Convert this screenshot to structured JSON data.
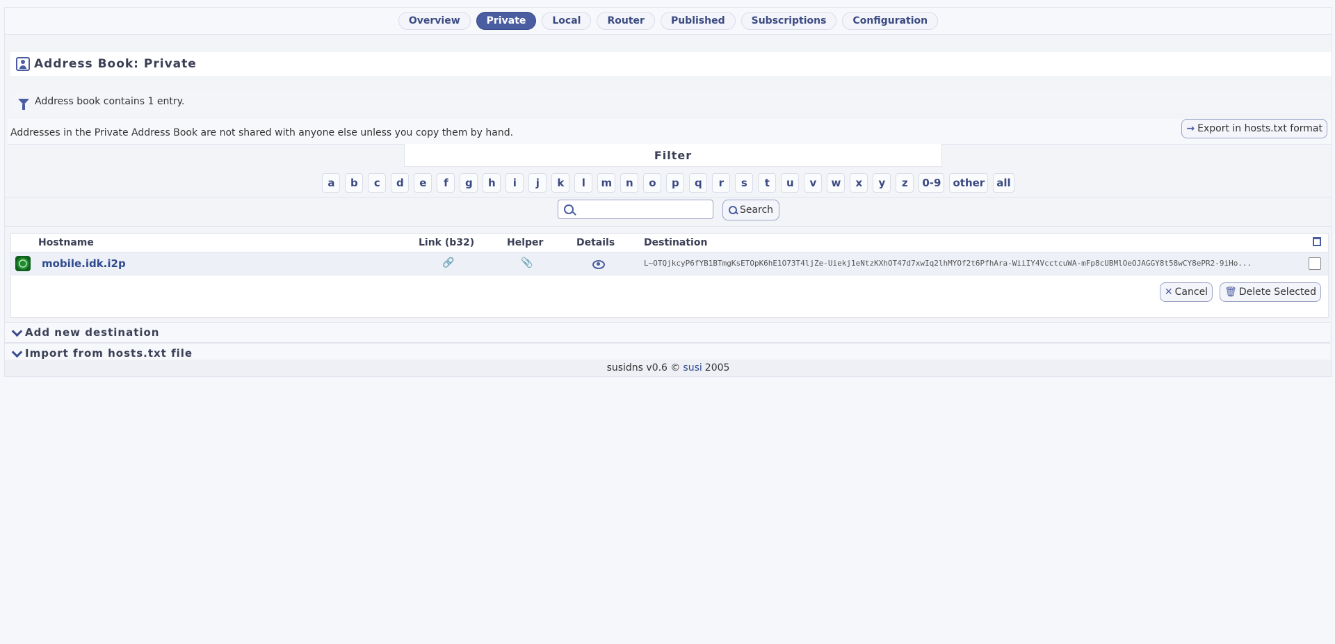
{
  "nav": {
    "tabs": [
      {
        "label": "Overview"
      },
      {
        "label": "Private",
        "active": true
      },
      {
        "label": "Local"
      },
      {
        "label": "Router"
      },
      {
        "label": "Published"
      },
      {
        "label": "Subscriptions"
      },
      {
        "label": "Configuration"
      }
    ]
  },
  "header": {
    "title": "Address Book: Private"
  },
  "info": {
    "text": "Address book contains 1 entry."
  },
  "notice": {
    "text": "Addresses in the Private Address Book are not shared with anyone else unless you copy them by hand.",
    "export_label": "Export in hosts.txt format"
  },
  "filter": {
    "title": "Filter",
    "letters": [
      "a",
      "b",
      "c",
      "d",
      "e",
      "f",
      "g",
      "h",
      "i",
      "j",
      "k",
      "l",
      "m",
      "n",
      "o",
      "p",
      "q",
      "r",
      "s",
      "t",
      "u",
      "v",
      "w",
      "x",
      "y",
      "z",
      "0-9",
      "other",
      "all"
    ]
  },
  "search": {
    "value": "",
    "placeholder": "",
    "button_label": "Search"
  },
  "table": {
    "headers": {
      "hostname": "Hostname",
      "link": "Link (b32)",
      "helper": "Helper",
      "details": "Details",
      "destination": "Destination"
    },
    "rows": [
      {
        "hostname": "mobile.idk.i2p",
        "destination": "L~OTQjkcyP6fYB1BTmgKsETOpK6hE1O73T4ljZe-Uiekj1eNtzKXhOT47d7xwIq2lhMYOf2t6PfhAra-WiiIY4VcctcuWA-mFp8cUBMlOeOJAGGY8t58wCY8ePR2-9iHo..."
      }
    ],
    "cancel_label": "Cancel",
    "delete_label": "Delete Selected"
  },
  "sections": {
    "add": "Add new destination",
    "import": "Import from hosts.txt file"
  },
  "footer": {
    "prefix": "susidns v0.6 ©",
    "link": "susi",
    "year": "2005"
  }
}
